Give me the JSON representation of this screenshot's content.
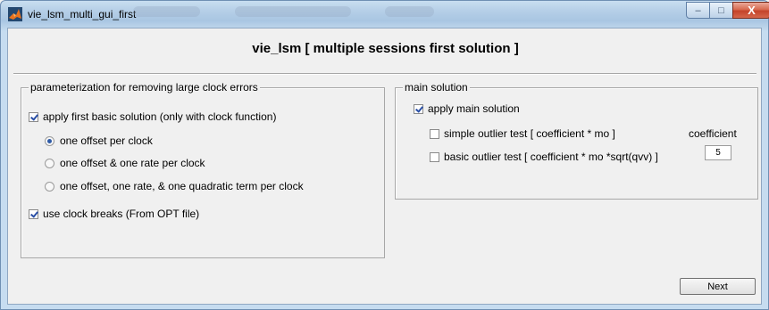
{
  "window": {
    "title": "vie_lsm_multi_gui_first",
    "minimize_glyph": "–",
    "maximize_glyph": "□",
    "close_glyph": "X"
  },
  "heading": "vie_lsm [ multiple sessions first solution ]",
  "left_panel": {
    "title": "parameterization for removing large clock errors",
    "basic_solution": {
      "label": "apply first basic solution (only with clock function)",
      "checked": true
    },
    "radios": [
      {
        "label": "one offset per clock",
        "selected": true
      },
      {
        "label": "one offset & one rate per clock",
        "selected": false
      },
      {
        "label": "one offset, one rate, & one quadratic term per clock",
        "selected": false
      }
    ],
    "clock_breaks": {
      "label": "use clock breaks (From OPT file)",
      "checked": true
    }
  },
  "right_panel": {
    "title": "main solution",
    "apply_main": {
      "label": "apply main solution",
      "checked": true
    },
    "simple_outlier": {
      "label": "simple outlier test [ coefficient * mo ]",
      "checked": false
    },
    "basic_outlier": {
      "label": "basic outlier test [ coefficient * mo *sqrt(qvv) ]",
      "checked": false
    },
    "coefficient_label": "coefficient",
    "coefficient_value": "5"
  },
  "buttons": {
    "next": "Next"
  },
  "icons": {
    "app": "matlab-icon"
  },
  "colors": {
    "accent": "#2e5aa6",
    "close": "#c4432a"
  }
}
